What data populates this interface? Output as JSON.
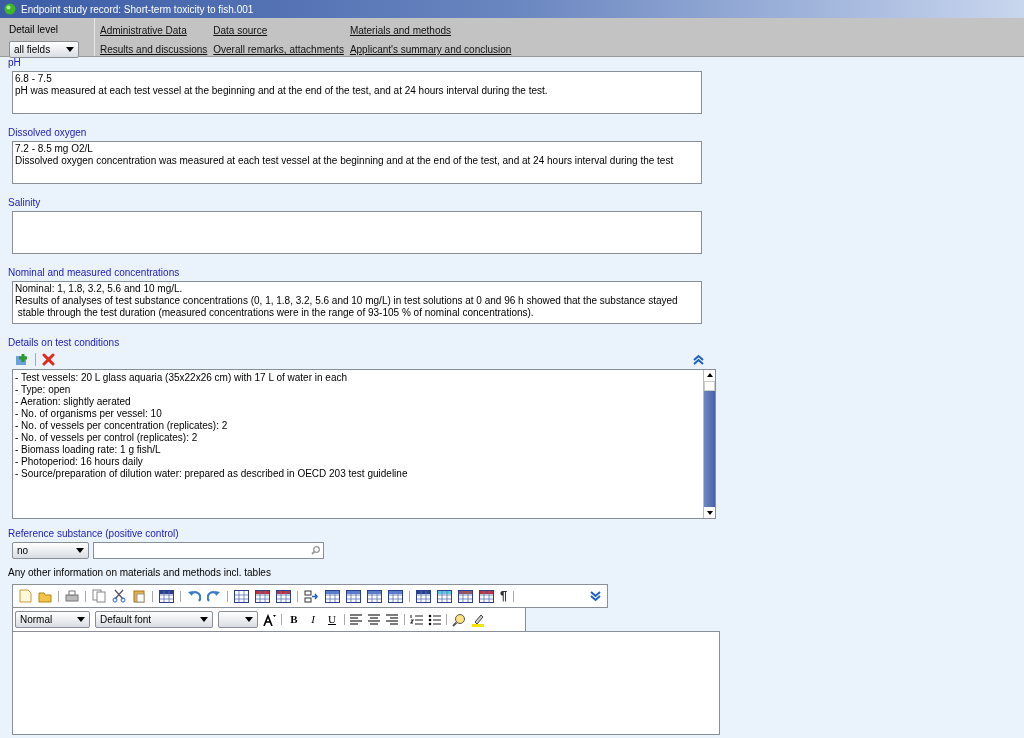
{
  "window": {
    "title": "Endpoint study record: Short-term toxicity to fish.001"
  },
  "header": {
    "detail_level_label": "Detail level",
    "detail_level": "all fields",
    "links": [
      {
        "label": "Administrative Data"
      },
      {
        "label": "Data source"
      },
      {
        "label": "Materials and methods"
      },
      {
        "label": "Results and discussions"
      },
      {
        "label": "Overall remarks, attachments"
      },
      {
        "label": "Applicant's summary and conclusion"
      }
    ]
  },
  "fields": [
    {
      "label": "pH",
      "lines": [
        "6.8 - 7.5",
        "pH was measured at each test vessel at the beginning and at the end of the test, and at 24 hours interval during the test."
      ]
    },
    {
      "label": "Dissolved oxygen",
      "lines": [
        "7.2 - 8.5 mg O2/L",
        "Dissolved oxygen concentration was measured at each test vessel at the beginning and at the end of the test, and at 24 hours interval during the test"
      ]
    },
    {
      "label": "Salinity"
    },
    {
      "label": "Nominal and measured concentrations",
      "lines": [
        "Nominal: 1, 1.8, 3.2, 5.6 and 10 mg/L.",
        "Results of analyses of test substance concentrations (0, 1, 1.8, 3.2, 5.6 and 10 mg/L) in test solutions at 0 and 96 h showed that the substance stayed",
        " stable through the test duration (measured concentrations were in the range of 93-105 % of nominal concentrations)."
      ]
    }
  ],
  "test_conditions": {
    "label": "Details on test conditions",
    "lines": [
      "- Test vessels: 20 L glass aquaria (35x22x26 cm) with 17 L of water in each",
      "- Type: open",
      "- Aeration: slightly aerated",
      "- No. of organisms per vessel: 10",
      "- No. of vessels per concentration (replicates): 2",
      "- No. of vessels per control (replicates): 2",
      "- Biomass loading rate: 1 g fish/L",
      "- Photoperiod: 16 hours daily",
      "- Source/preparation of dilution water: prepared as described in OECD 203 test guideline"
    ]
  },
  "reference_substance": {
    "label": "Reference substance (positive control)",
    "value": "no"
  },
  "other_information": {
    "label": "Any other information on materials and methods incl. tables",
    "paragraph_style": "Normal",
    "font": "Default font",
    "format_buttons": [
      "B",
      "I",
      "U"
    ],
    "pilcrow": "¶"
  }
}
